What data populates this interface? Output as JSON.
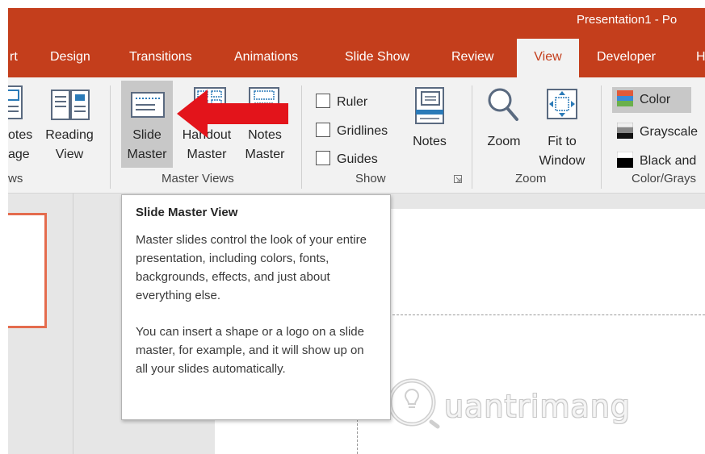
{
  "window": {
    "title": "Presentation1  -  Po"
  },
  "tabs": [
    {
      "label": "rt"
    },
    {
      "label": "Design"
    },
    {
      "label": "Transitions"
    },
    {
      "label": "Animations"
    },
    {
      "label": "Slide Show"
    },
    {
      "label": "Review"
    },
    {
      "label": "View"
    },
    {
      "label": "Developer"
    },
    {
      "label": "H"
    }
  ],
  "active_tab": "View",
  "ribbon": {
    "views": {
      "notes_page": {
        "line1": "otes",
        "line2": "age"
      },
      "reading_view": {
        "line1": "Reading",
        "line2": "View"
      },
      "group_label": "ws"
    },
    "master_views": {
      "slide_master": {
        "line1": "Slide",
        "line2": "Master"
      },
      "handout_master": {
        "line1": "Handout",
        "line2": "Master"
      },
      "notes_master": {
        "line1": "Notes",
        "line2": "Master"
      },
      "group_label": "Master Views"
    },
    "show": {
      "ruler": "Ruler",
      "gridlines": "Gridlines",
      "guides": "Guides",
      "notes": "Notes",
      "group_label": "Show"
    },
    "zoom": {
      "zoom": "Zoom",
      "fit_to_window": {
        "line1": "Fit to",
        "line2": "Window"
      },
      "group_label": "Zoom"
    },
    "color_grayscale": {
      "color": "Color",
      "grayscale": "Grayscale",
      "black_and_white": "Black and",
      "group_label": "Color/Grays"
    }
  },
  "tooltip": {
    "title": "Slide Master View",
    "paragraph1": "Master slides control the look of your entire presentation, including colors, fonts, backgrounds, effects, and just about everything else.",
    "paragraph2": "You can insert a shape or a logo on a slide master, for example, and it will show up on all your slides automatically."
  },
  "watermark": {
    "text": "uantrimang"
  },
  "colors": {
    "accent": "#c43e1c",
    "arrow": "#e3141b",
    "thumbnail_border": "#e46c4e"
  }
}
